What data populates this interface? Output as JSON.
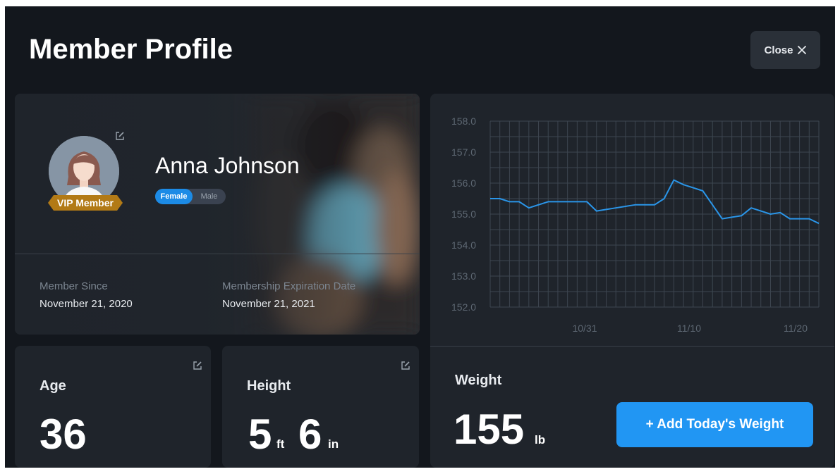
{
  "header": {
    "title": "Member Profile",
    "close_label": "Close"
  },
  "profile": {
    "name": "Anna Johnson",
    "badge": "VIP Member",
    "gender_options": [
      "Female",
      "Male"
    ],
    "gender_selected": "Female",
    "member_since_label": "Member Since",
    "member_since": "November 21, 2020",
    "expiration_label": "Membership Expiration Date",
    "expiration": "November 21, 2021"
  },
  "age": {
    "label": "Age",
    "value": "36"
  },
  "height": {
    "label": "Height",
    "feet": "5",
    "feet_unit": "ft",
    "inches": "6",
    "inches_unit": "in"
  },
  "weight": {
    "label": "Weight",
    "value": "155",
    "unit": "lb",
    "add_button": "+ Add Today's Weight"
  },
  "colors": {
    "accent": "#2196f3",
    "line": "#2a95e8",
    "card": "#1f242b",
    "background": "#13171d"
  },
  "icons": {
    "close": "close-icon",
    "edit": "edit-icon"
  },
  "chart_data": {
    "type": "line",
    "x_tick_labels": [
      "10/31",
      "11/10",
      "11/20"
    ],
    "y_tick_labels": [
      "158.0",
      "157.0",
      "156.0",
      "155.0",
      "154.0",
      "153.0",
      "152.0"
    ],
    "ylim": [
      152,
      158
    ],
    "grid": true,
    "x": [
      "10/22",
      "10/23",
      "10/24",
      "10/25",
      "10/26",
      "10/27",
      "10/28",
      "10/29",
      "10/30",
      "10/31",
      "11/1",
      "11/2",
      "11/3",
      "11/4",
      "11/5",
      "11/6",
      "11/7",
      "11/8",
      "11/9",
      "11/10",
      "11/11",
      "11/12",
      "11/13",
      "11/14",
      "11/15",
      "11/16",
      "11/17",
      "11/18",
      "11/19",
      "11/20",
      "11/21",
      "11/22"
    ],
    "series": [
      {
        "values": [
          155.5,
          155.5,
          155.4,
          155.4,
          155.2,
          155.3,
          155.4,
          155.4,
          155.4,
          155.4,
          155.4,
          155.1,
          155.15,
          155.2,
          155.25,
          155.3,
          155.3,
          155.3,
          155.5,
          156.1,
          155.95,
          155.85,
          155.75,
          155.3,
          154.85,
          154.9,
          154.95,
          155.2,
          155.1,
          155.0,
          155.05,
          154.85,
          154.85,
          154.85,
          154.7
        ]
      }
    ]
  }
}
